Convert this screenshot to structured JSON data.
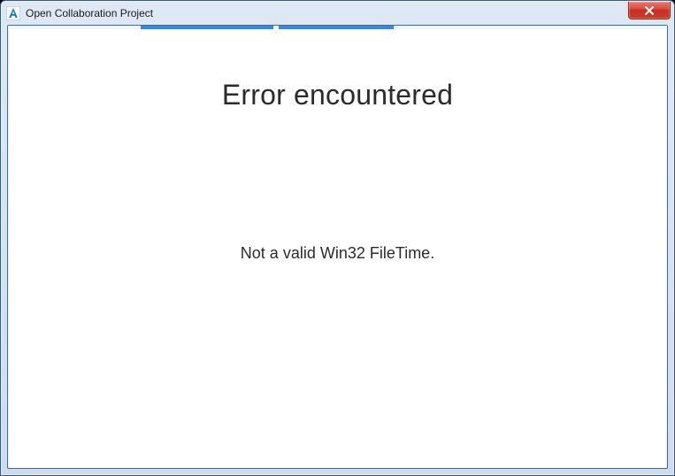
{
  "window": {
    "title": "Open Collaboration Project"
  },
  "content": {
    "heading": "Error encountered",
    "message": "Not a valid Win32 FileTime."
  },
  "colors": {
    "accent": "#3a86d8",
    "close": "#c62f22"
  }
}
